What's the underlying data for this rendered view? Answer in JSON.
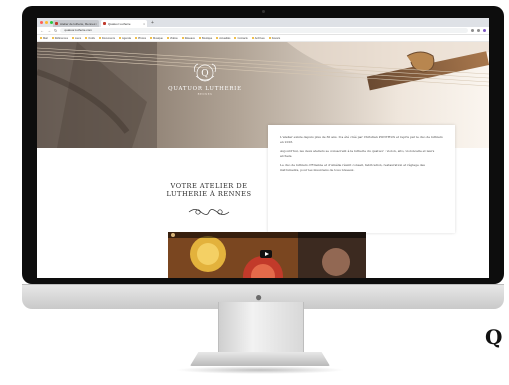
{
  "browser": {
    "tabs": [
      {
        "label": "Atelier de lutherie, Rennes",
        "active": false
      },
      {
        "label": "Quatuor Lutherie",
        "active": true
      }
    ],
    "new_tab": "+",
    "url": "quatuor-lutherie.com",
    "icons": [
      "back-icon",
      "forward-icon",
      "reload-icon",
      "home-icon"
    ],
    "bookmarks": [
      "Mail",
      "Références",
      "Liens",
      "Outils",
      "Documents",
      "Agenda",
      "Photos",
      "Musique",
      "Vidéos",
      "Réseaux",
      "Boutique",
      "Actualités",
      "Contacts",
      "Archives",
      "Favoris"
    ]
  },
  "site": {
    "brand": "QUATUOR LUTHERIE",
    "brand_sub": "RENNES",
    "logo_letter": "Q",
    "section_title_line1": "VOTRE ATELIER DE",
    "section_title_line2": "LUTHERIE À RENNES",
    "paragraphs": [
      "L'atelier existe depuis plus de 30 ans. Il a été créé par Christian PONTHUS et repris par le duo de luthiers en 2016.",
      "Aujourd'hui, les deux ateliers se consacrent à la lutherie du quatuor : violon, alto, violoncelle et leurs archets.",
      "Le duo de luthiers d'Etienne et d'Amélie réunit conseil, fabrication, restauration et réglage des instruments, pour les musiciens de tous niveaux."
    ]
  },
  "colors": {
    "bezel": "#0d0d0d",
    "hero_gold": "#c9a86a",
    "text": "#444444"
  }
}
